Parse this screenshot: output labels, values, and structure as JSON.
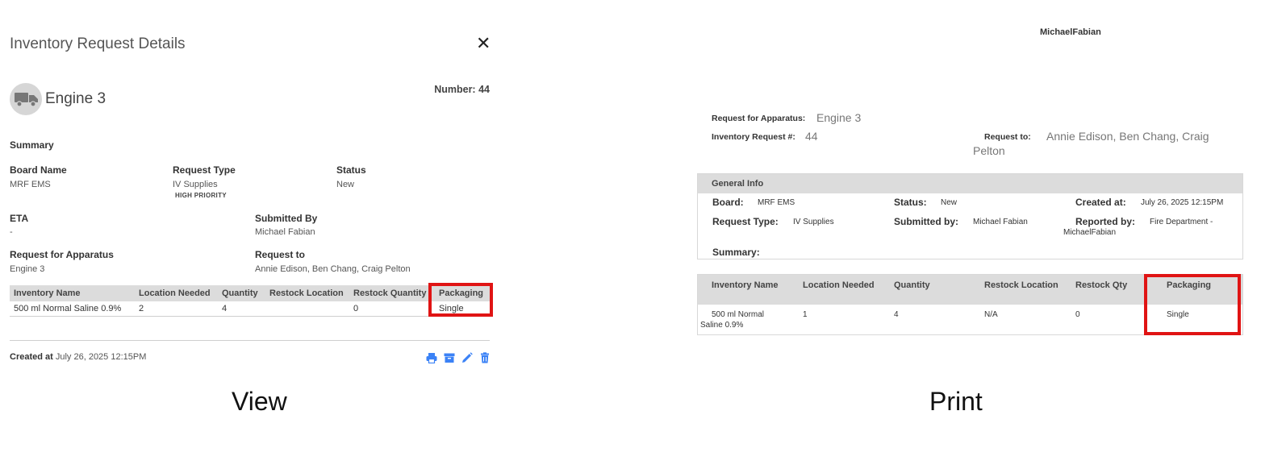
{
  "view": {
    "title": "Inventory Request Details",
    "apparatus_name": "Engine 3",
    "number_label": "Number:",
    "number_value": "44",
    "summary_label": "Summary",
    "fields": {
      "board_name_label": "Board Name",
      "board_name_value": "MRF EMS",
      "request_type_label": "Request Type",
      "request_type_value": "IV Supplies",
      "priority_tag": "HIGH PRIORITY",
      "status_label": "Status",
      "status_value": "New",
      "eta_label": "ETA",
      "eta_value": "-",
      "submitted_by_label": "Submitted By",
      "submitted_by_value": "Michael Fabian",
      "request_for_apparatus_label": "Request for Apparatus",
      "request_for_apparatus_value": "Engine 3",
      "request_to_label": "Request to",
      "request_to_value": "Annie Edison, Ben Chang, Craig Pelton"
    },
    "table": {
      "headers": [
        "Inventory Name",
        "Location Needed",
        "Quantity",
        "Restock Location",
        "Restock Quantity",
        "Packaging"
      ],
      "rows": [
        [
          "500 ml Normal Saline 0.9%",
          "2",
          "4",
          "",
          "0",
          "Single"
        ]
      ]
    },
    "created_label": "Created at",
    "created_value": "July 26, 2025 12:15PM",
    "caption": "View"
  },
  "print": {
    "username": "MichaelFabian",
    "request_for_apparatus_label": "Request for Apparatus:",
    "request_for_apparatus_value": "Engine 3",
    "inventory_request_label": "Inventory Request #:",
    "inventory_request_value": "44",
    "request_to_label": "Request to:",
    "request_to_value_line1": "Annie Edison, Ben Chang, Craig",
    "request_to_value_line2": "Pelton",
    "general_info_title": "General Info",
    "board_label": "Board:",
    "board_value": "MRF EMS",
    "status_label": "Status:",
    "status_value": "New",
    "created_at_label": "Created at:",
    "created_at_value": "July 26, 2025 12:15PM",
    "request_type_label": "Request Type:",
    "request_type_value": "IV Supplies",
    "submitted_by_label": "Submitted by:",
    "submitted_by_value": "Michael Fabian",
    "reported_by_label": "Reported by:",
    "reported_by_value_line1": "Fire Department -",
    "reported_by_value_line2": "MichaelFabian",
    "summary_label": "Summary:",
    "table": {
      "headers": [
        "Inventory Name",
        "Location Needed",
        "Quantity",
        "Restock Location",
        "Restock Qty",
        "Packaging"
      ],
      "row": {
        "name_line1": "500 ml Normal",
        "name_line2": "Saline 0.9%",
        "location": "1",
        "quantity": "4",
        "restock_location": "N/A",
        "restock_qty": "0",
        "packaging": "Single"
      }
    },
    "caption": "Print"
  },
  "colors": {
    "highlight": "#e01414",
    "action_icon": "#3b82f6",
    "header_bg": "#dcdcdc"
  },
  "icons": {
    "avatar": "truck-icon",
    "close": "close-icon",
    "actions": [
      "print-icon",
      "archive-icon",
      "edit-icon",
      "delete-icon"
    ]
  }
}
